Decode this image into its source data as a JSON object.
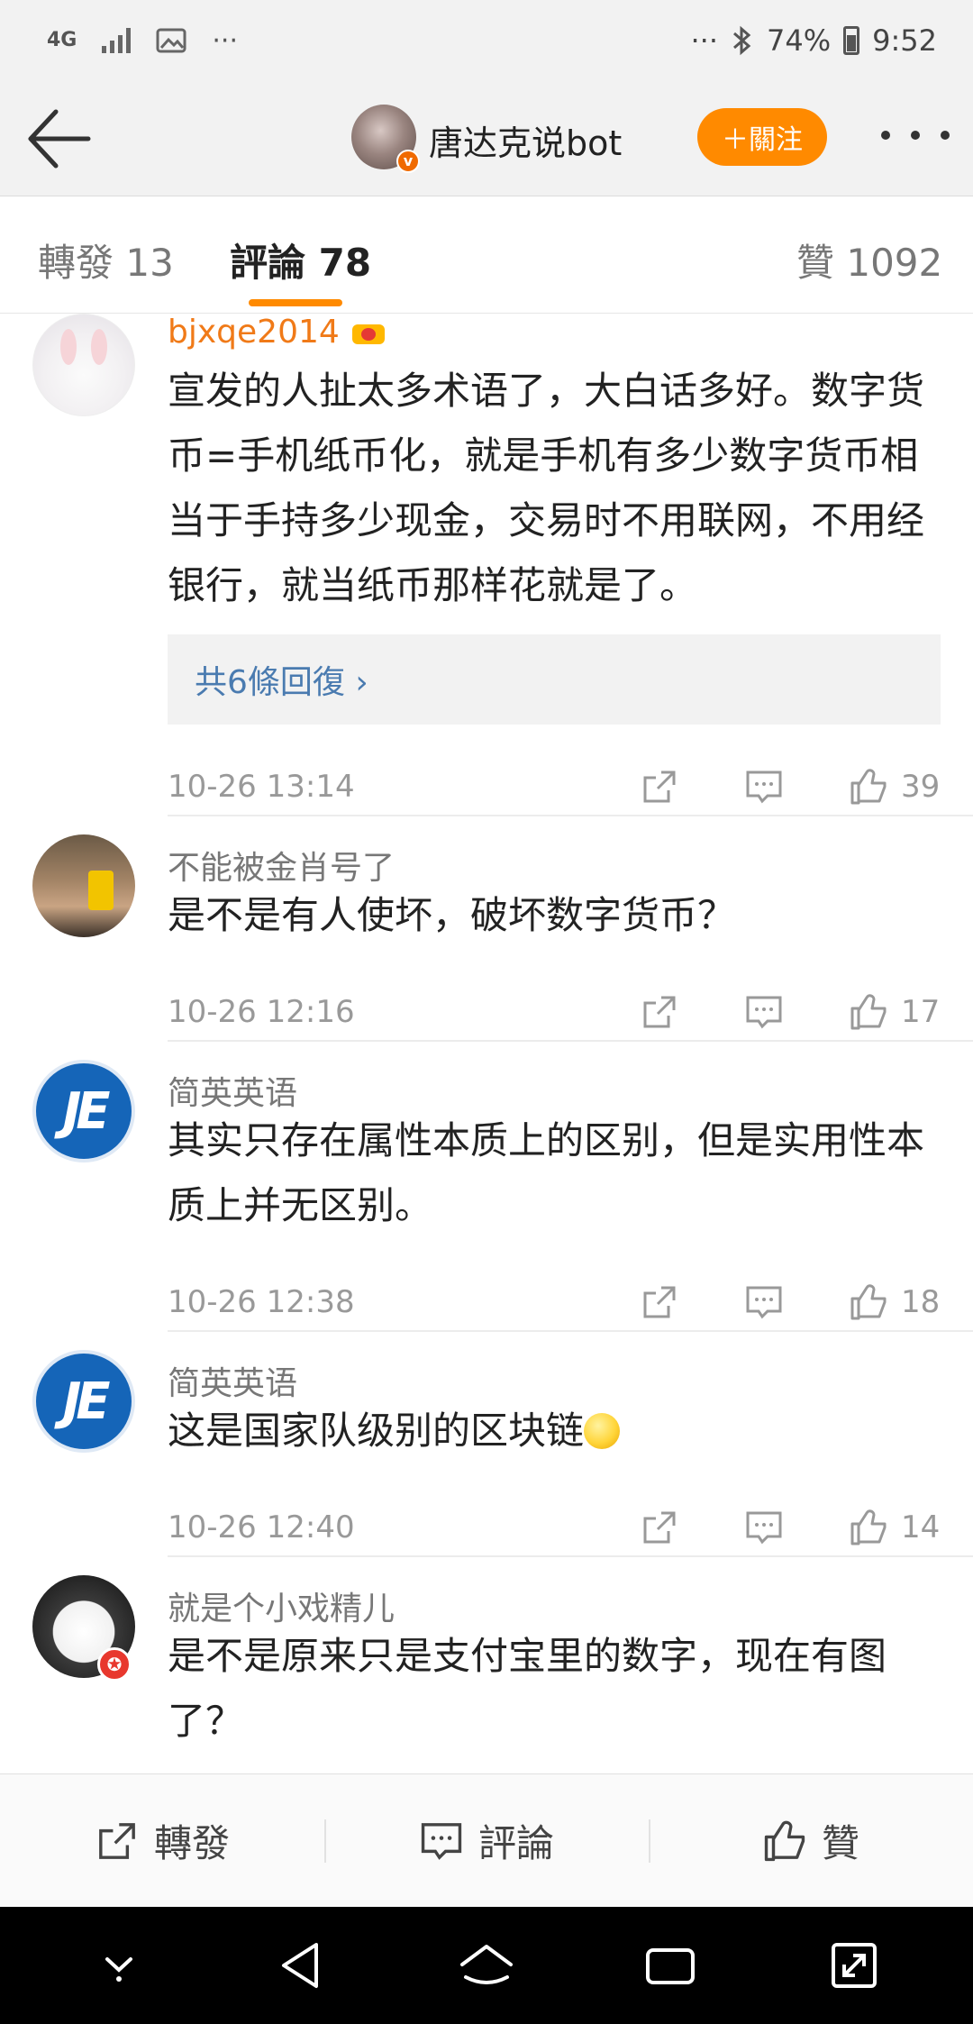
{
  "status_bar": {
    "network": "4G",
    "notif_more": "···",
    "right_more": "···",
    "battery": "74%",
    "time": "9:52"
  },
  "header": {
    "title": "唐达克说bot",
    "verified_badge": "v",
    "follow_label": "＋關注"
  },
  "tabs": [
    {
      "label": "轉發 13",
      "active": false
    },
    {
      "label": "評論 78",
      "active": true
    },
    {
      "label": "贊 1092",
      "active": false
    }
  ],
  "comments": [
    {
      "user": "bjxqe2014",
      "text": "宣发的人扯太多术语了，大白话多好。数字货币=手机纸币化，就是手机有多少数字货币相当于手持多少现金，交易时不用联网，不用经银行，就当纸币那样花就是了。",
      "replies": "共6條回復 ›",
      "time": "10-26 13:14",
      "likes": "39"
    },
    {
      "user": "不能被金肖号了",
      "text": "是不是有人使坏，破坏数字货币？",
      "time": "10-26 12:16",
      "likes": "17"
    },
    {
      "user": "简英英语",
      "avatar_text": "JE",
      "text": "其实只存在属性本质上的区别，但是实用性本质上并无区别。",
      "time": "10-26 12:38",
      "likes": "18"
    },
    {
      "user": "简英英语",
      "avatar_text": "JE",
      "text": "这是国家队级别的区块链",
      "time": "10-26 12:40",
      "likes": "14"
    },
    {
      "user": "就是个小戏精儿",
      "text": "是不是原来只是支付宝里的数字，现在有图了？"
    }
  ],
  "action_bar": {
    "repost": "轉發",
    "comment": "評論",
    "like": "贊"
  },
  "colors": {
    "accent": "#ff8a00",
    "link": "#4a7bb0",
    "username_vip": "#f07a18"
  }
}
